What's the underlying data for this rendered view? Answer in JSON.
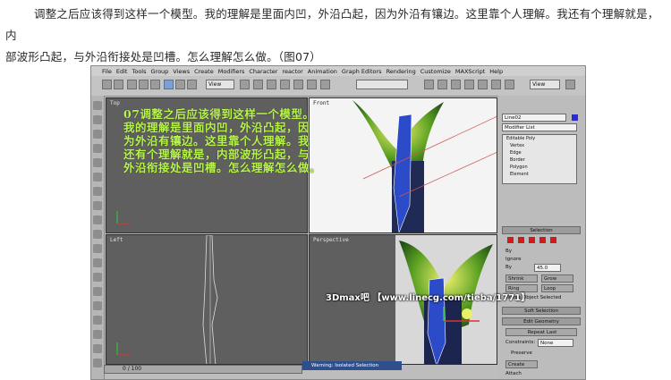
{
  "caption": {
    "line1": "调整之后应该得到这样一个模型。我的理解是里面内凹，外沿凸起，因为外沿有镶边。这里靠个人理解。我还有个理解就是，内",
    "line2": "部波形凸起，与外沿衔接处是凹槽。怎么理解怎么做。（图07）"
  },
  "menu": [
    "File",
    "Edit",
    "Tools",
    "Group",
    "Views",
    "Create",
    "Modifiers",
    "Character",
    "reactor",
    "Animation",
    "Graph Editors",
    "Rendering",
    "Customize",
    "MAXScript",
    "Help"
  ],
  "toolbar": {
    "view_select_1": "View",
    "view_select_2": "View"
  },
  "viewports": {
    "top": "Top",
    "front": "Front",
    "left": "Left",
    "perspective": "Perspective"
  },
  "overlay": {
    "l1": "07调整之后应该得到这样一个模型。",
    "l2": "我的理解是里面内凹，外沿凸起，因",
    "l3": "为外沿有镶边。这里靠个人理解。我",
    "l4": "还有个理解就是，内部波形凸起，与",
    "l5": "外沿衔接处是凹槽。怎么理解怎么做。"
  },
  "panel": {
    "object_name": "Line02",
    "modifier_list": "Modifier List",
    "stack": [
      "Editable Poly",
      "Vertex",
      "Edge",
      "Border",
      "Polygon",
      "Element"
    ],
    "selection": "Selection",
    "by_vertex": "By",
    "ignore": "Ignore",
    "by_angle": "By",
    "angle_value": "45.0",
    "shrink": "Shrink",
    "grow": "Grow",
    "ring": "Ring",
    "loop": "Loop",
    "whole": "Whole Object Selected",
    "soft_selection": "Soft Selection",
    "edit_geometry": "Edit Geometry",
    "repeat_last": "Repeat Last",
    "constraints": "Constraints:",
    "constraints_value": "None",
    "preserve": "Preserve",
    "create": "Create",
    "attach": "Attach"
  },
  "timeline": "0 / 100",
  "warning": "Warning: Isolated Selection",
  "watermark": "3Dmax吧 【www.linecg.com/tieba/1771】",
  "colors": {
    "overlay_text": "#b7f54a",
    "viewport_bg": "#5f5f5f",
    "warning_bar": "#2e4e8c"
  }
}
